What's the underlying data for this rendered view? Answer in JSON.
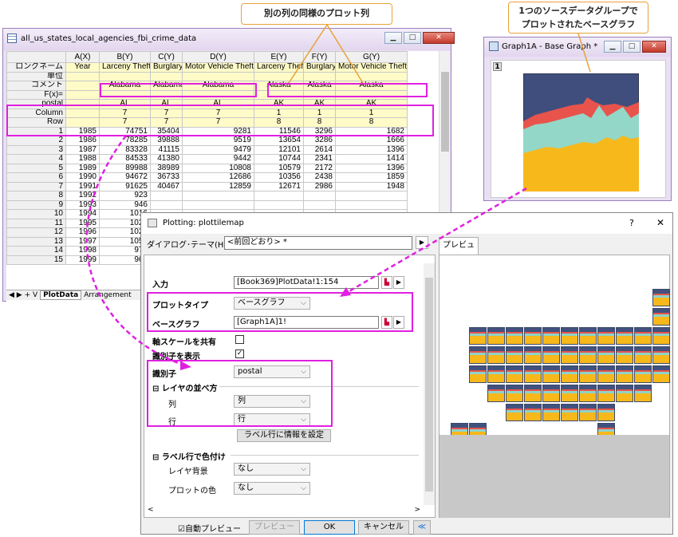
{
  "callouts": {
    "same_col": "別の列の同様のプロット列",
    "base_graph": "1つのソースデータグループで\nプロットされたベースグラフ"
  },
  "worksheet": {
    "title": "all_us_states_local_agencies_fbi_crime_data",
    "columns": [
      "",
      "A(X)",
      "B(Y)",
      "C(Y)",
      "D(Y)",
      "E(Y)",
      "F(Y)",
      "G(Y)"
    ],
    "label_rows": [
      [
        "ロングネーム",
        "Year",
        "Larceny Theft",
        "Burglary",
        "Motor Vehicle Theft",
        "Larceny Theft",
        "Burglary",
        "Motor Vehicle Theft"
      ],
      [
        "単位",
        "",
        "",
        "",
        "",
        "",
        "",
        ""
      ],
      [
        "コメント",
        "",
        "Alabama",
        "Alabama",
        "Alabama",
        "Alaska",
        "Alaska",
        "Alaska"
      ],
      [
        "F(x)=",
        "",
        "",
        "",
        "",
        "",
        "",
        ""
      ],
      [
        "postal",
        "",
        "AL",
        "AL",
        "AL",
        "AK",
        "AK",
        "AK"
      ],
      [
        "Column",
        "",
        "7",
        "7",
        "7",
        "1",
        "1",
        "1"
      ],
      [
        "Row",
        "",
        "7",
        "7",
        "7",
        "8",
        "8",
        "8"
      ]
    ],
    "data_rows": [
      [
        "1",
        "1985",
        "74751",
        "35404",
        "9281",
        "11546",
        "3296",
        "1682"
      ],
      [
        "2",
        "1986",
        "78285",
        "39888",
        "9519",
        "13654",
        "3286",
        "1666"
      ],
      [
        "3",
        "1987",
        "83328",
        "41115",
        "9479",
        "12101",
        "2614",
        "1396"
      ],
      [
        "4",
        "1988",
        "84533",
        "41380",
        "9442",
        "10744",
        "2341",
        "1414"
      ],
      [
        "5",
        "1989",
        "89988",
        "38989",
        "10808",
        "10579",
        "2172",
        "1396"
      ],
      [
        "6",
        "1990",
        "94672",
        "36733",
        "12686",
        "10356",
        "2438",
        "1859"
      ],
      [
        "7",
        "1991",
        "91625",
        "40467",
        "12859",
        "12671",
        "2986",
        "1948"
      ],
      [
        "8",
        "1992",
        "923",
        "",
        "",
        "",
        "",
        ""
      ],
      [
        "9",
        "1993",
        "946",
        "",
        "",
        "",
        "",
        ""
      ],
      [
        "10",
        "1994",
        "1016",
        "",
        "",
        "",
        "",
        ""
      ],
      [
        "11",
        "1995",
        "1021",
        "",
        "",
        "",
        "",
        ""
      ],
      [
        "12",
        "1996",
        "1027",
        "",
        "",
        "",
        "",
        ""
      ],
      [
        "13",
        "1997",
        "1055",
        "",
        "",
        "",
        "",
        ""
      ],
      [
        "14",
        "1998",
        "977",
        "",
        "",
        "",
        "",
        ""
      ],
      [
        "15",
        "1999",
        "967",
        "",
        "",
        "",
        "",
        ""
      ]
    ],
    "tabs": [
      "PlotData",
      "Arrangement"
    ]
  },
  "graph_window": {
    "title": "Graph1A - Base Graph *",
    "layer": "1"
  },
  "dialog": {
    "title": "Plotting: plottilemap",
    "help": "?",
    "close": "✕",
    "theme_label": "ダイアログ･テーマ(H)",
    "theme_value": "<前回どおり> *",
    "preview_tab": "プレビュー",
    "input_label": "入力",
    "input_value": "[Book369]PlotData!1:154",
    "plot_type_label": "プロットタイプ",
    "plot_type_value": "ベースグラフ",
    "base_graph_label": "ベースグラフ",
    "base_graph_value": "[Graph1A]1!",
    "share_axis_label": "軸スケールを共有",
    "show_id_label": "識別子を表示",
    "show_id_check": "✓",
    "identifier_label": "識別子",
    "identifier_value": "postal",
    "arrange_label": "⊟ レイヤの並べ方",
    "col_label": "列",
    "col_value": "列",
    "row_label": "行",
    "row_value": "行",
    "set_label_btn": "ラベル行に情報を設定",
    "color_label": "⊟ ラベル行で色付け",
    "layer_bg_label": "レイヤ背景",
    "layer_bg_value": "なし",
    "plot_color_label": "プロットの色",
    "plot_color_value": "なし",
    "auto_preview": "☑自動プレビュー",
    "preview_btn": "プレビュー",
    "ok": "OK",
    "cancel": "キャンセル",
    "collapse": "≪"
  }
}
